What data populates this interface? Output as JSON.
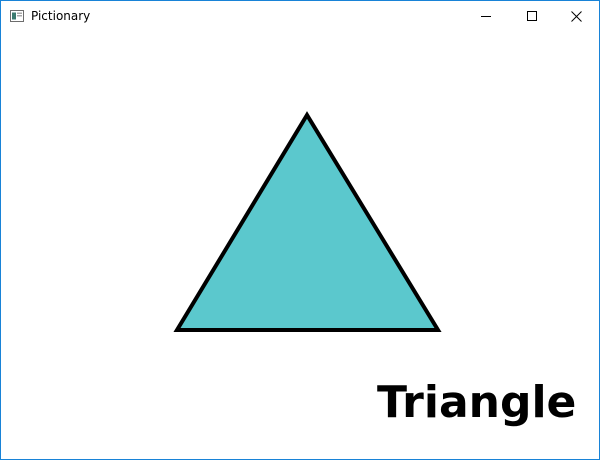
{
  "window": {
    "title": "Pictionary",
    "icon": "app-window-icon",
    "controls": {
      "minimize_icon": "minimize-icon",
      "maximize_icon": "maximize-icon",
      "close_icon": "close-icon"
    }
  },
  "picture": {
    "shape": "triangle",
    "fill_color": "#5bc8cd",
    "stroke_color": "#000000"
  },
  "word": "Triangle"
}
